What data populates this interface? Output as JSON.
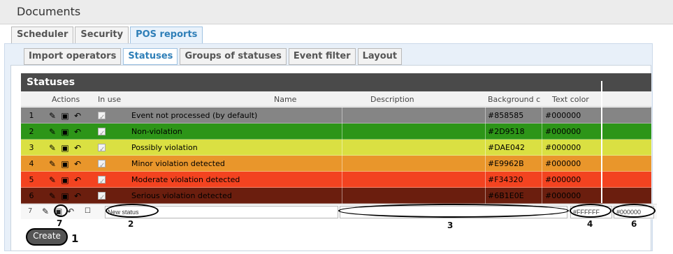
{
  "window": {
    "title": "Documents"
  },
  "top_tabs": [
    {
      "label": "Scheduler",
      "active": false
    },
    {
      "label": "Security",
      "active": false
    },
    {
      "label": "POS reports",
      "active": true
    }
  ],
  "inner_tabs": [
    {
      "label": "Import operators",
      "active": false
    },
    {
      "label": "Statuses",
      "active": true
    },
    {
      "label": "Groups of statuses",
      "active": false
    },
    {
      "label": "Event filter",
      "active": false
    },
    {
      "label": "Layout",
      "active": false
    }
  ],
  "grid": {
    "title": "Statuses",
    "columns": {
      "actions": "Actions",
      "in_use": "In use",
      "name": "Name",
      "description": "Description",
      "background": "Background c",
      "text_color": "Text color"
    },
    "rows": [
      {
        "num": "1",
        "name": "Event not processed (by default)",
        "description": "",
        "background": "#858585",
        "text_color": "#000000",
        "row_color": "#858585",
        "font_color": "#000000"
      },
      {
        "num": "2",
        "name": "Non-violation",
        "description": "",
        "background": "#2D9518",
        "text_color": "#000000",
        "row_color": "#2D9518",
        "font_color": "#000000"
      },
      {
        "num": "3",
        "name": "Possibly violation",
        "description": "",
        "background": "#DAE042",
        "text_color": "#000000",
        "row_color": "#DAE042",
        "font_color": "#000000"
      },
      {
        "num": "4",
        "name": "Minor violation detected",
        "description": "",
        "background": "#E9962B",
        "text_color": "#000000",
        "row_color": "#E9962B",
        "font_color": "#000000"
      },
      {
        "num": "5",
        "name": "Moderate violation detected",
        "description": "",
        "background": "#F34320",
        "text_color": "#000000",
        "row_color": "#F34320",
        "font_color": "#000000"
      },
      {
        "num": "6",
        "name": "Serious violation detected",
        "description": "",
        "background": "#6B1E0E",
        "text_color": "#000000",
        "row_color": "#6B1E0E",
        "font_color": "#000000"
      }
    ]
  },
  "new_row": {
    "num": "7",
    "name_value": "New status",
    "description_value": "",
    "background_value": "#FFFFFF",
    "text_color_value": "#000000"
  },
  "callouts": {
    "c1": "1",
    "c2": "2",
    "c3": "3",
    "c4": "4",
    "c6": "6",
    "c7": "7"
  },
  "create_button": {
    "label": "Create"
  }
}
